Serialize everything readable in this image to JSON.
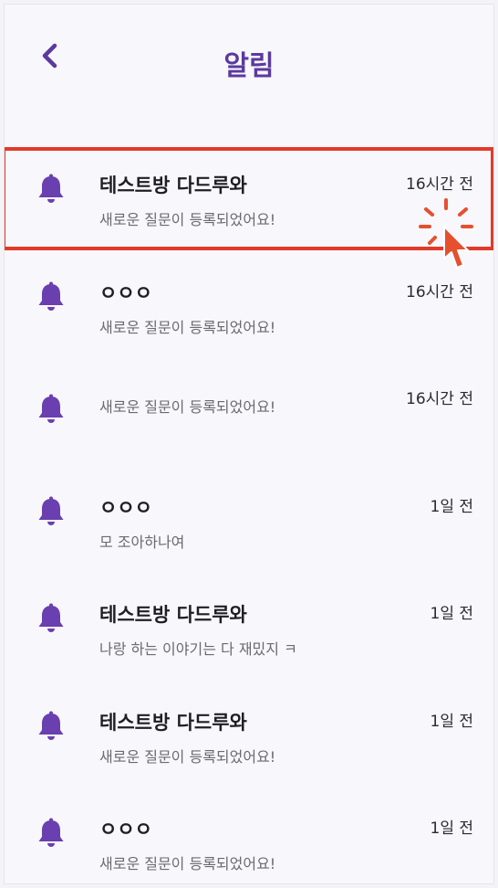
{
  "header": {
    "title": "알림",
    "back_icon": "chevron-left-icon"
  },
  "colors": {
    "accent": "#5b3a9e",
    "bell": "#6a3fb0",
    "highlight": "#e23a2a",
    "cursor": "#e5502e"
  },
  "notifications": [
    {
      "title": "테스트방 다드루와",
      "message": "새로운 질문이 등록되었어요!",
      "time": "16시간 전"
    },
    {
      "title": "ㅇㅇㅇ",
      "message": "새로운 질문이 등록되었어요!",
      "time": "16시간 전"
    },
    {
      "title": "",
      "message": "새로운 질문이 등록되었어요!",
      "time": "16시간 전"
    },
    {
      "title": "ㅇㅇㅇ",
      "message": "모 조아하나여",
      "time": "1일 전"
    },
    {
      "title": "테스트방 다드루와",
      "message": "나랑 하는 이야기는 다 재밌지 ㅋ",
      "time": "1일 전"
    },
    {
      "title": "테스트방 다드루와",
      "message": "새로운 질문이 등록되었어요!",
      "time": "1일 전"
    },
    {
      "title": "ㅇㅇㅇ",
      "message": "새로운 질문이 등록되었어요!",
      "time": "1일 전"
    }
  ]
}
